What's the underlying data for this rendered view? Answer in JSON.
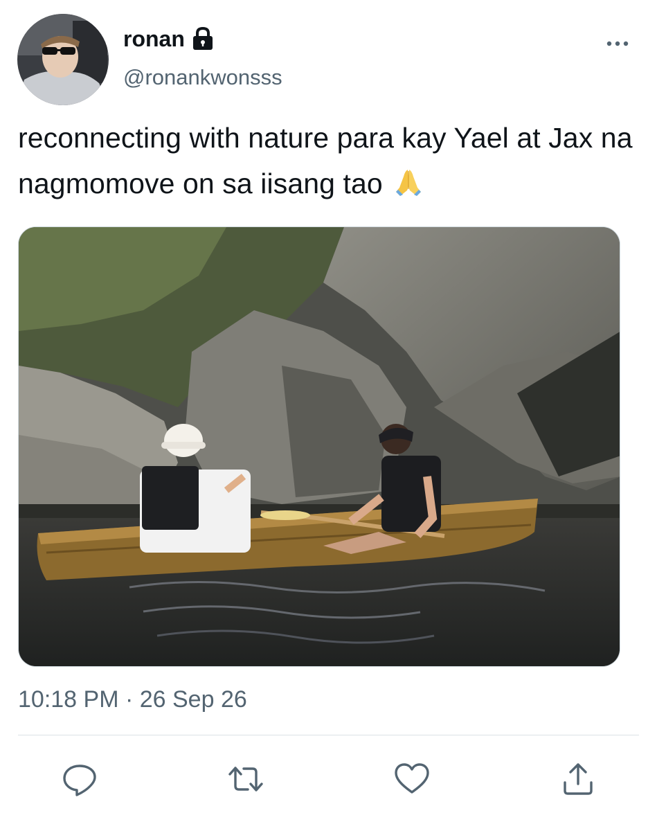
{
  "user": {
    "display_name": "ronan",
    "handle": "@ronankwonsss",
    "protected_icon": "lock-icon"
  },
  "tweet": {
    "text": "reconnecting with nature para kay Yael at Jax na nagmomove on sa iisang tao",
    "emoji": "folded-hands-icon",
    "timestamp": "10:18 PM · 26 Sep 26"
  },
  "actions": {
    "reply_icon": "reply-icon",
    "retweet_icon": "retweet-icon",
    "like_icon": "heart-icon",
    "share_icon": "share-icon",
    "more_icon": "more-icon"
  },
  "colors": {
    "text_primary": "#0f1419",
    "text_secondary": "#536471",
    "icon": "#536471",
    "divider": "#dbe1e6"
  }
}
